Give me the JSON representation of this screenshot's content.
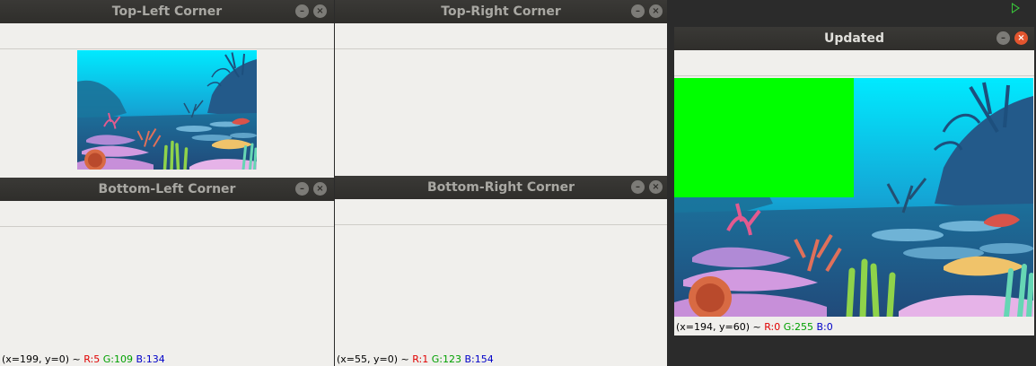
{
  "windows": {
    "top_left": {
      "title": "Top-Left Corner"
    },
    "top_right": {
      "title": "Top-Right Corner"
    },
    "bottom_left": {
      "title": "Bottom-Left Corner",
      "status": {
        "coords": "(x=199, y=0) ~",
        "r": "R:5",
        "g": "G:109",
        "b": "B:134"
      }
    },
    "bottom_right": {
      "title": "Bottom-Right Corner",
      "status": {
        "coords": "(x=55, y=0) ~",
        "r": "R:1",
        "g": "G:123",
        "b": "B:154"
      }
    },
    "updated": {
      "title": "Updated",
      "status": {
        "coords": "(x=194, y=60) ~",
        "r": "R:0",
        "g": "G:255",
        "b": "B:0"
      },
      "overlay_color": "#00ff00"
    }
  },
  "icons": {
    "minimize": "minimize-icon",
    "close": "close-icon",
    "run": "play-icon"
  },
  "colors": {
    "titlebar": "#2f2e2b",
    "water_top": "#00e5ff",
    "water_deep": "#0a5c8a",
    "close_active": "#e3552e"
  }
}
